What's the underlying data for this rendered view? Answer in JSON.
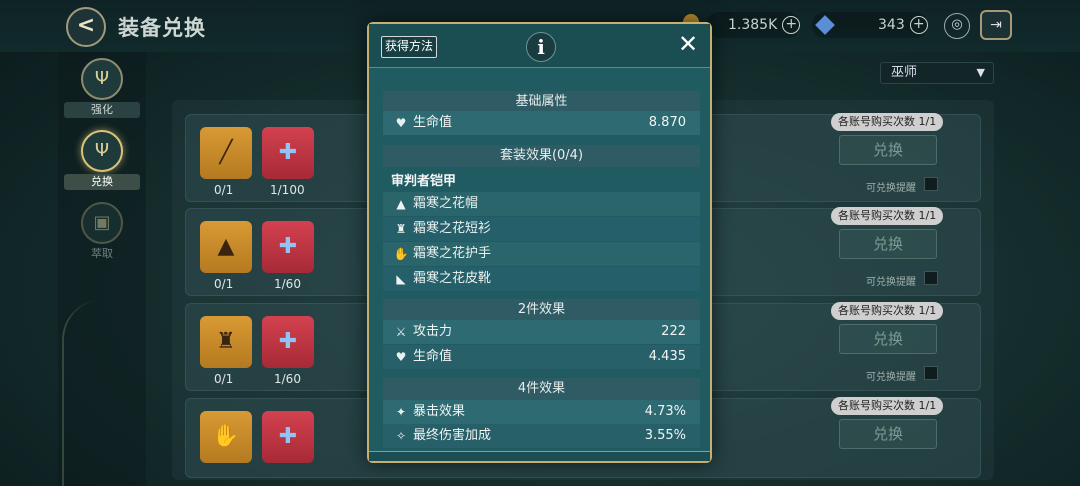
{
  "header": {
    "title": "装备兑换",
    "back_glyph": "<"
  },
  "currency": {
    "gold": "1.385K",
    "gems": "343",
    "plus": "+"
  },
  "sidebar": {
    "items": [
      {
        "label": "强化"
      },
      {
        "label": "兑换"
      },
      {
        "label": "萃取"
      }
    ]
  },
  "class_select": {
    "value": "巫师",
    "arrow": "▼"
  },
  "rows": [
    {
      "item_count": "0/1",
      "material_count": "1/100",
      "limit": "各账号购买次数 1/1",
      "button": "兑换",
      "remind": "可兑换提醒"
    },
    {
      "item_count": "0/1",
      "material_count": "1/60",
      "limit": "各账号购买次数 1/1",
      "button": "兑换",
      "remind": "可兑换提醒"
    },
    {
      "item_count": "0/1",
      "material_count": "1/60",
      "limit": "各账号购买次数 1/1",
      "button": "兑换",
      "remind": "可兑换提醒"
    },
    {
      "item_count": "",
      "material_count": "",
      "limit": "各账号购买次数 1/1",
      "button": "兑换",
      "remind": ""
    }
  ],
  "modal": {
    "source_button": "获得方法",
    "info_glyph": "i",
    "close_glyph": "✕",
    "basic": {
      "title": "基础属性",
      "stats": [
        {
          "name": "生命值",
          "value": "8.870"
        }
      ]
    },
    "set": {
      "title": "套装效果(0/4)",
      "set_name": "审判者铠甲",
      "pieces": [
        "霜寒之花帽",
        "霜寒之花短衫",
        "霜寒之花护手",
        "霜寒之花皮靴"
      ]
    },
    "two_piece": {
      "title": "2件效果",
      "stats": [
        {
          "name": "攻击力",
          "value": "222"
        },
        {
          "name": "生命值",
          "value": "4.435"
        }
      ]
    },
    "four_piece": {
      "title": "4件效果",
      "stats": [
        {
          "name": "暴击效果",
          "value": "4.73%"
        },
        {
          "name": "最终伤害加成",
          "value": "3.55%"
        }
      ]
    }
  },
  "icons": {
    "heart": "heart-icon",
    "sword": "crossed-swords-icon",
    "crit": "crit-icon",
    "final_dmg": "final-damage-icon"
  }
}
